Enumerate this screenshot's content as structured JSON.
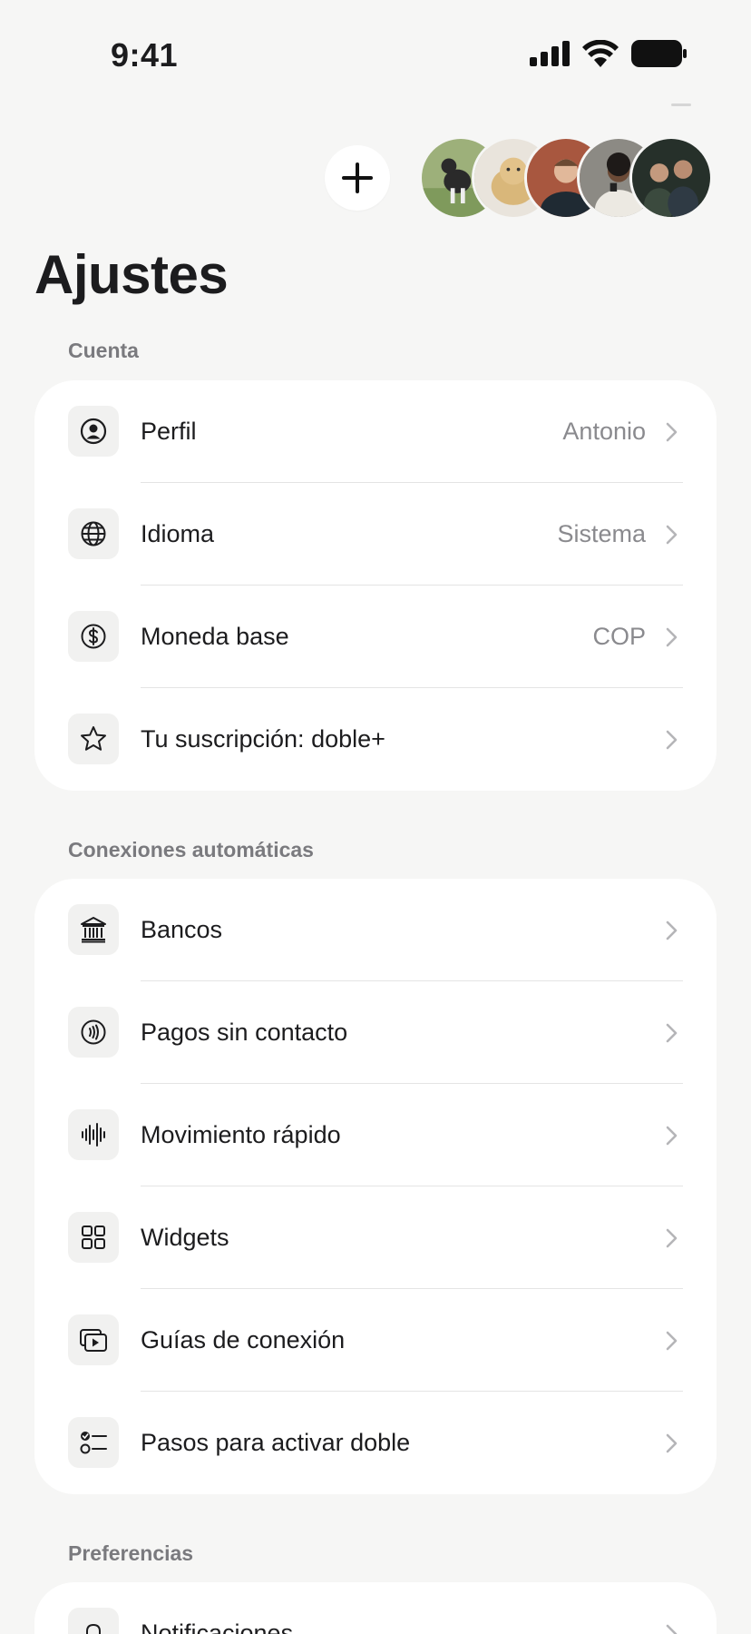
{
  "status_bar": {
    "time": "9:41"
  },
  "page": {
    "title": "Ajustes"
  },
  "sections": [
    {
      "label": "Cuenta",
      "items": [
        {
          "label": "Perfil",
          "value": "Antonio",
          "icon": "person-circle-icon"
        },
        {
          "label": "Idioma",
          "value": "Sistema",
          "icon": "globe-icon"
        },
        {
          "label": "Moneda base",
          "value": "COP",
          "icon": "dollar-circle-icon"
        },
        {
          "label": "Tu suscripción: doble+",
          "value": "",
          "icon": "star-icon"
        }
      ]
    },
    {
      "label": "Conexiones automáticas",
      "items": [
        {
          "label": "Bancos",
          "icon": "bank-icon"
        },
        {
          "label": "Pagos sin contacto",
          "icon": "contactless-icon"
        },
        {
          "label": "Movimiento rápido",
          "icon": "waveform-icon"
        },
        {
          "label": "Widgets",
          "icon": "grid-icon"
        },
        {
          "label": "Guías de conexión",
          "icon": "video-guides-icon"
        },
        {
          "label": "Pasos para activar doble",
          "icon": "checklist-icon"
        }
      ]
    },
    {
      "label": "Preferencias",
      "items": [
        {
          "label": "Notificaciones",
          "icon": "bell-icon"
        }
      ]
    }
  ],
  "colors": {
    "background": "#f6f6f5",
    "card": "#ffffff",
    "icon_box": "#f1f1f0",
    "muted_text": "#8a8a8e"
  }
}
